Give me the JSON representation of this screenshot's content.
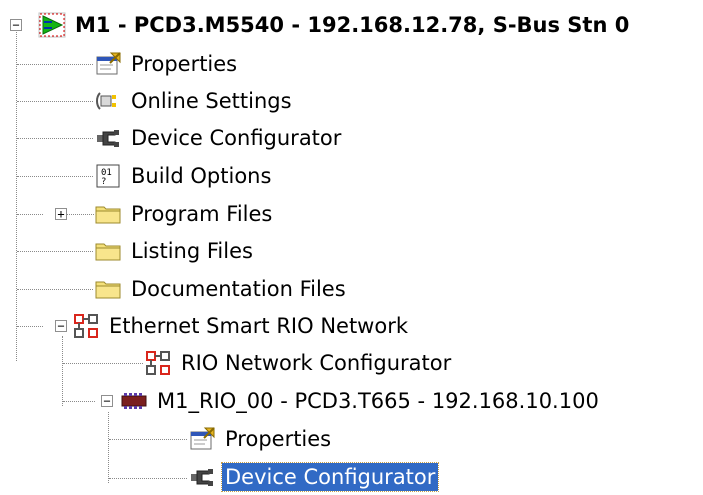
{
  "tree": {
    "root": {
      "label": "M1 - PCD3.M5540 - 192.168.12.78, S-Bus Stn 0",
      "icon": "device-run-icon",
      "expanded": true
    },
    "items": [
      {
        "label": "Properties",
        "icon": "properties-icon"
      },
      {
        "label": "Online Settings",
        "icon": "online-settings-icon"
      },
      {
        "label": "Device Configurator",
        "icon": "device-configurator-icon"
      },
      {
        "label": "Build Options",
        "icon": "build-options-icon"
      },
      {
        "label": "Program Files",
        "icon": "folder-icon",
        "expander": "+"
      },
      {
        "label": "Listing Files",
        "icon": "folder-icon"
      },
      {
        "label": "Documentation Files",
        "icon": "folder-icon"
      },
      {
        "label": "Ethernet Smart RIO Network",
        "icon": "network-icon",
        "expander": "−"
      },
      {
        "label": "RIO Network Configurator",
        "icon": "network-icon"
      },
      {
        "label": "M1_RIO_00 - PCD3.T665 - 192.168.10.100",
        "icon": "rio-module-icon",
        "expander": "−"
      },
      {
        "label": "Properties",
        "icon": "properties-icon"
      },
      {
        "label": "Device Configurator",
        "icon": "device-configurator-icon",
        "selected": true
      }
    ],
    "root_expander": "−"
  },
  "colors": {
    "selection": "#316ac5",
    "folder": "#f4e07a",
    "network": "#d9261c"
  }
}
